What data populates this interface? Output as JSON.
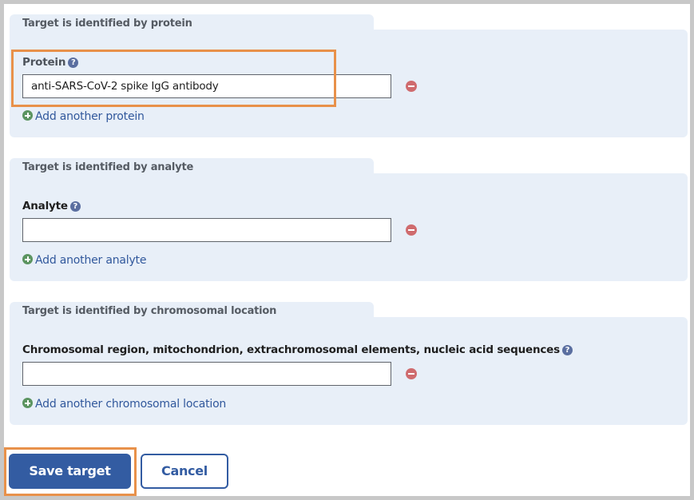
{
  "sections": [
    {
      "legend": "Target is identified by protein",
      "field_label": "Protein",
      "input_value": "anti-SARS-CoV-2 spike IgG antibody",
      "add_link": "Add another protein"
    },
    {
      "legend": "Target is identified by analyte",
      "field_label": "Analyte",
      "input_value": "",
      "add_link": "Add another analyte"
    },
    {
      "legend": "Target is identified by chromosomal location",
      "field_label": "Chromosomal region, mitochondrion, extrachromosomal elements, nucleic acid sequences",
      "input_value": "",
      "add_link": "Add another chromosomal location"
    }
  ],
  "icons": {
    "help": "?",
    "remove": "minus-circle-icon",
    "add": "plus-circle-icon"
  },
  "buttons": {
    "save": "Save target",
    "cancel": "Cancel"
  },
  "colors": {
    "primary": "#335ca2",
    "highlight": "#e8914a",
    "panel": "#e8eff8",
    "remove": "#cf6b6e",
    "add": "#5b9460"
  }
}
